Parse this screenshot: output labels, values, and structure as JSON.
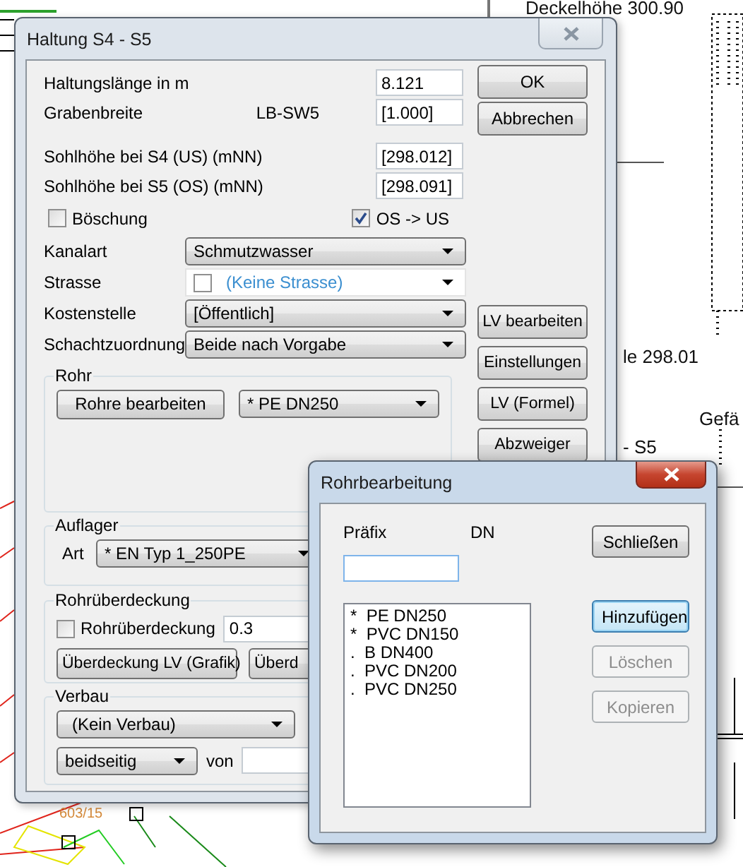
{
  "background": {
    "labels": [
      {
        "text": "Deckelhöhe 300.90"
      },
      {
        "text": "le 298.01"
      },
      {
        "text": "Gefä"
      },
      {
        "text": "- S5"
      },
      {
        "text": "603/15"
      }
    ]
  },
  "main_dialog": {
    "title": "Haltung S4 - S5",
    "value_rows": [
      {
        "label": "Haltungslänge in m",
        "value": "8.121"
      },
      {
        "label": "Grabenbreite",
        "note": "LB-SW5",
        "value": "[1.000]"
      }
    ],
    "level_rows": [
      {
        "label": "Sohlhöhe bei S4 (US) (mNN)",
        "value": "[298.012]"
      },
      {
        "label": "Sohlhöhe bei S5 (OS) (mNN)",
        "value": "[298.091]"
      }
    ],
    "checks": [
      {
        "label": "Böschung",
        "checked": false
      },
      {
        "label": "OS -> US",
        "checked": true
      }
    ],
    "selects": [
      {
        "kind": "dropdown",
        "label": "Kanalart",
        "value": "Schmutzwasser"
      },
      {
        "kind": "street",
        "label": "Strasse",
        "value": "(Keine Strasse)",
        "checked": false
      },
      {
        "kind": "dropdown",
        "label": "Kostenstelle",
        "value": "[Öffentlich]"
      },
      {
        "kind": "dropdown",
        "label": "Schachtzuordnung",
        "value": "Beide nach Vorgabe"
      }
    ],
    "top_buttons": [
      "OK",
      "Abbrechen"
    ],
    "side_buttons": [
      "LV bearbeiten",
      "Einstellungen",
      "LV (Formel)",
      "Abzweiger"
    ],
    "rohr": {
      "title": "Rohr",
      "button": "Rohre bearbeiten",
      "select": "*  PE DN250"
    },
    "auflager": {
      "title": "Auflager",
      "label": "Art",
      "select": "*  EN Typ 1_250PE"
    },
    "cover": {
      "title": "Rohrüberdeckung",
      "check": {
        "label": "Rohrüberdeckung",
        "checked": false
      },
      "value": "0.3",
      "buttons": [
        "Überdeckung LV (Grafik)",
        "Überd"
      ]
    },
    "verbau": {
      "title": "Verbau",
      "select": "(Kein Verbau)",
      "side": "beidseitig",
      "from_label": "von"
    }
  },
  "pipe_dialog": {
    "title": "Rohrbearbeitung",
    "prefix_label": "Präfix",
    "dn_label": "DN",
    "items": [
      "*  PE DN250",
      "*  PVC DN150",
      ".  B DN400",
      ".  PVC DN200",
      ".  PVC DN250"
    ],
    "buttons": [
      {
        "label": "Schließen",
        "disabled": false,
        "focused": false
      },
      {
        "label": "Hinzufügen",
        "disabled": false,
        "focused": true
      },
      {
        "label": "Löschen",
        "disabled": true,
        "focused": false
      },
      {
        "label": "Kopieren",
        "disabled": true,
        "focused": false
      }
    ]
  }
}
